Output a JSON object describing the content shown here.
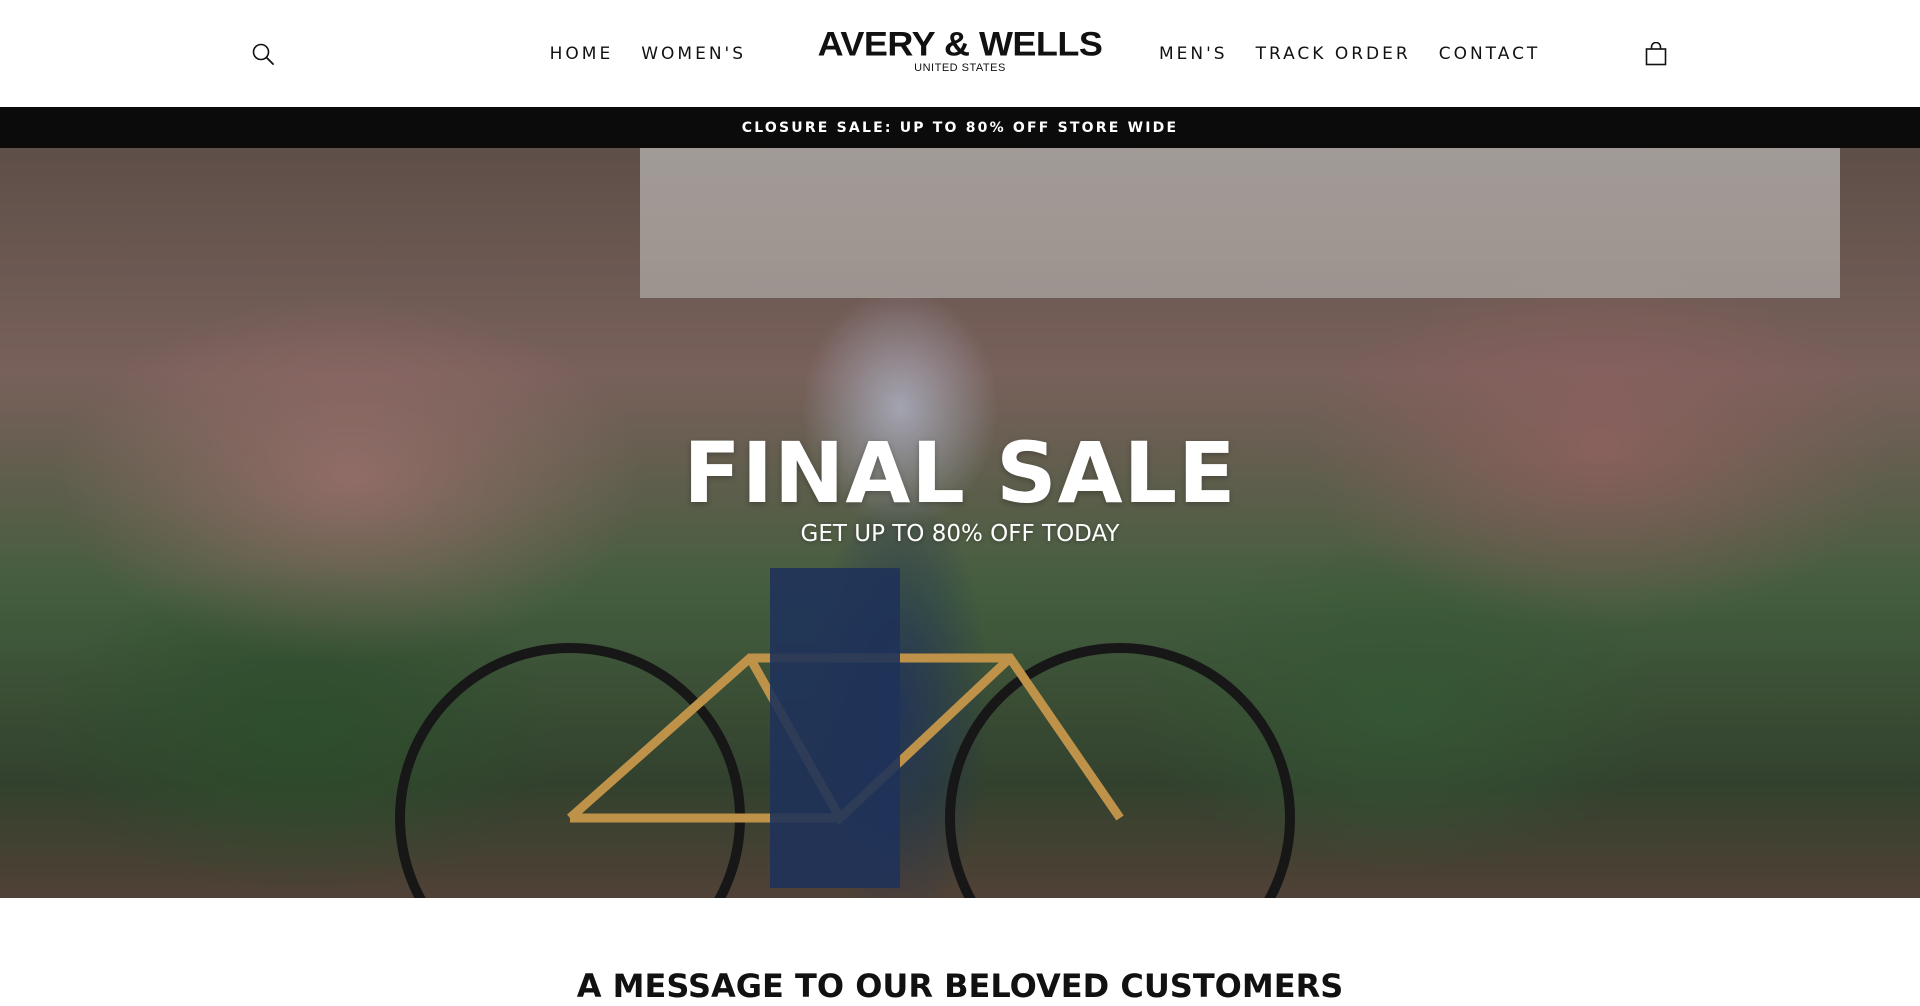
{
  "header": {
    "logo": {
      "name": "AVERY & WELLS",
      "subtitle": "UNITED STATES"
    },
    "nav_left": [
      {
        "label": "HOME"
      },
      {
        "label": "WOMEN'S"
      }
    ],
    "nav_right": [
      {
        "label": "MEN'S"
      },
      {
        "label": "TRACK ORDER"
      },
      {
        "label": "CONTACT"
      }
    ],
    "icons": {
      "search": "search-icon",
      "cart": "shopping-bag-icon"
    }
  },
  "announcement": {
    "text": "CLOSURE SALE: UP TO 80% OFF STORE WIDE"
  },
  "hero": {
    "title": "FINAL SALE",
    "subtitle": "GET UP TO 80% OFF TODAY"
  },
  "message_section": {
    "heading": "A MESSAGE TO OUR BELOVED CUSTOMERS"
  },
  "colors": {
    "header_bg": "#ffffff",
    "announcement_bg": "#0b0b0b",
    "text_dark": "#111111",
    "text_light": "#ffffff"
  }
}
